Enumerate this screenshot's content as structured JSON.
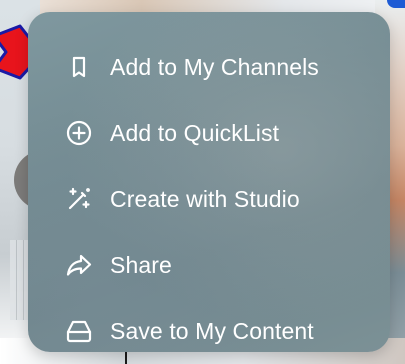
{
  "menu": {
    "items": [
      {
        "label": "Add to My Channels",
        "icon": "bookmark-icon"
      },
      {
        "label": "Add to QuickList",
        "icon": "plus-circle-icon"
      },
      {
        "label": "Create with Studio",
        "icon": "magic-wand-icon"
      },
      {
        "label": "Share",
        "icon": "share-arrow-icon"
      },
      {
        "label": "Save to My Content",
        "icon": "drive-icon"
      }
    ]
  },
  "colors": {
    "menu_background": "#748c93",
    "menu_text": "#ffffff",
    "pointer_fill": "#e8141c",
    "pointer_stroke": "#1a1aa6"
  }
}
